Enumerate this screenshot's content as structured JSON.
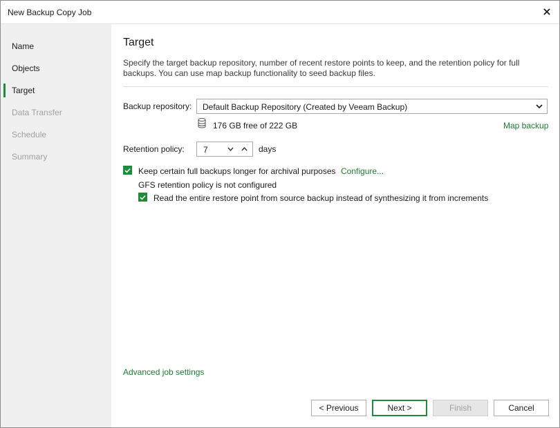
{
  "window": {
    "title": "New Backup Copy Job"
  },
  "sidebar": {
    "items": [
      {
        "label": "Name",
        "state": "enabled"
      },
      {
        "label": "Objects",
        "state": "enabled"
      },
      {
        "label": "Target",
        "state": "active"
      },
      {
        "label": "Data Transfer",
        "state": "disabled"
      },
      {
        "label": "Schedule",
        "state": "disabled"
      },
      {
        "label": "Summary",
        "state": "disabled"
      }
    ]
  },
  "page": {
    "title": "Target",
    "description": "Specify the target backup repository, number of recent restore points to keep, and the retention policy for full backups. You can use map backup functionality to seed backup files."
  },
  "repository": {
    "label": "Backup repository:",
    "selected": "Default Backup Repository (Created by Veeam Backup)",
    "free_space": "176 GB free of 222 GB",
    "map_link": "Map backup"
  },
  "retention": {
    "label": "Retention policy:",
    "value": "7",
    "unit": "days"
  },
  "archival": {
    "checkbox_label": "Keep certain full backups longer for archival purposes",
    "checked": true,
    "configure_link": "Configure...",
    "gfs_status": "GFS retention policy is not configured",
    "read_entire_label": "Read the entire restore point from source backup instead of synthesizing it from increments",
    "read_entire_checked": true
  },
  "advanced_link": "Advanced job settings",
  "buttons": {
    "previous": "< Previous",
    "next": "Next >",
    "finish": "Finish",
    "cancel": "Cancel"
  },
  "colors": {
    "accent": "#1f8a3a",
    "link": "#1f7a34",
    "sidebar_bg": "#f0f0f0"
  }
}
